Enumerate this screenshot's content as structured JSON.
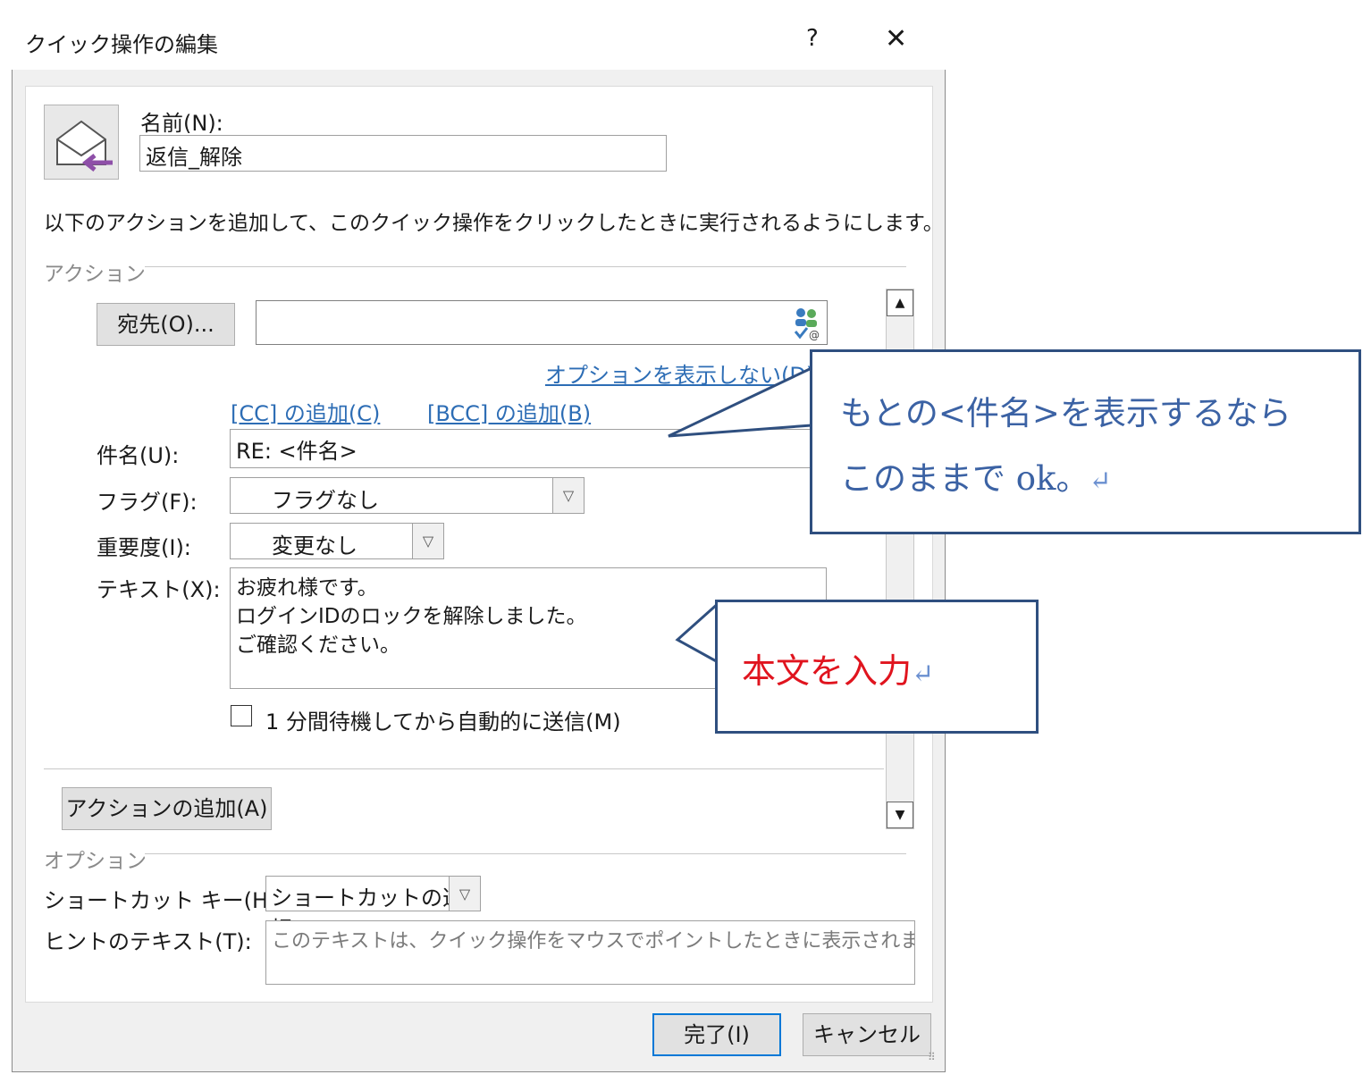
{
  "window": {
    "title": "クイック操作の編集",
    "help": "?",
    "close": "✕"
  },
  "name_label": "名前(N):",
  "name_value": "返信_解除",
  "description": "以下のアクションを追加して、このクイック操作をクリックしたときに実行されるようにします。",
  "actions_section": "アクション",
  "to_button": "宛先(O)...",
  "to_value": "",
  "hide_options_link": "オプションを表示しない(D)",
  "cc_link": "[CC] の追加(C)",
  "bcc_link": "[BCC] の追加(B)",
  "subject_label": "件名(U):",
  "subject_value": "RE: <件名>",
  "flag_label": "フラグ(F):",
  "flag_value": "フラグなし",
  "importance_label": "重要度(I):",
  "importance_value": "変更なし",
  "text_label": "テキスト(X):",
  "text_lines": [
    "お疲れ様です。",
    "ログインIDのロックを解除しました。",
    "ご確認ください。"
  ],
  "auto_send_label": "1 分間待機してから自動的に送信(M)",
  "add_action_button": "アクションの追加(A)",
  "options_section": "オプション",
  "shortcut_label": "ショートカット キー(H):",
  "shortcut_value": "ショートカットの選択",
  "tooltip_label": "ヒントのテキスト(T):",
  "tooltip_placeholder": "このテキストは、クイック操作をマウスでポイントしたときに表示されます。",
  "finish_button": "完了(I)",
  "cancel_button": "キャンセル",
  "callout1": {
    "line1": "もとの<件名>を表示するなら",
    "line2": "このままで ok。",
    "mark": "↵"
  },
  "callout2": {
    "text": "本文を入力",
    "mark": "↵"
  },
  "colors": {
    "callout_border": "#2f4f7f",
    "callout1_text": "#3b62a4",
    "callout2_text": "#e0141e",
    "link": "#2d6db5"
  }
}
